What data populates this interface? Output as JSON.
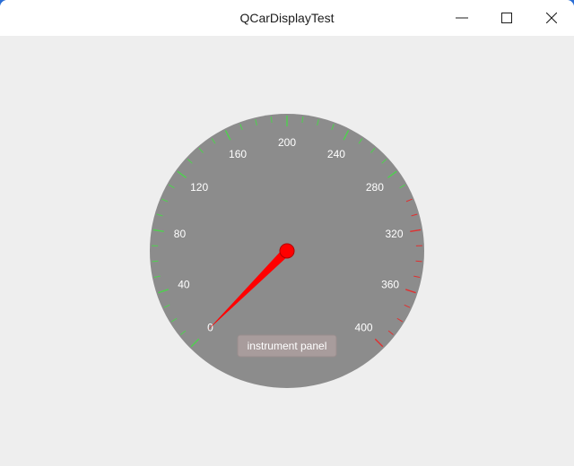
{
  "window": {
    "title": "QCarDisplayTest",
    "buttons": {
      "minimize_icon": "minimize-icon",
      "maximize_icon": "maximize-icon",
      "close_icon": "close-icon"
    }
  },
  "gauge": {
    "min": 0,
    "max": 400,
    "value": 0,
    "label_step": 40,
    "minor_step": 10,
    "tick_labels": [
      "0",
      "40",
      "80",
      "120",
      "160",
      "200",
      "240",
      "280",
      "320",
      "360",
      "400"
    ],
    "panel_label": "instrument panel",
    "colors": {
      "face": "#8c8c8c",
      "normal_tick": "#4dd24d",
      "warning_tick": "#e03030",
      "needle": "#ff0000",
      "label": "#ffffff",
      "panel_bg": "#a89c9c",
      "panel_border": "#9a8e8e"
    },
    "warning_from": 300
  }
}
